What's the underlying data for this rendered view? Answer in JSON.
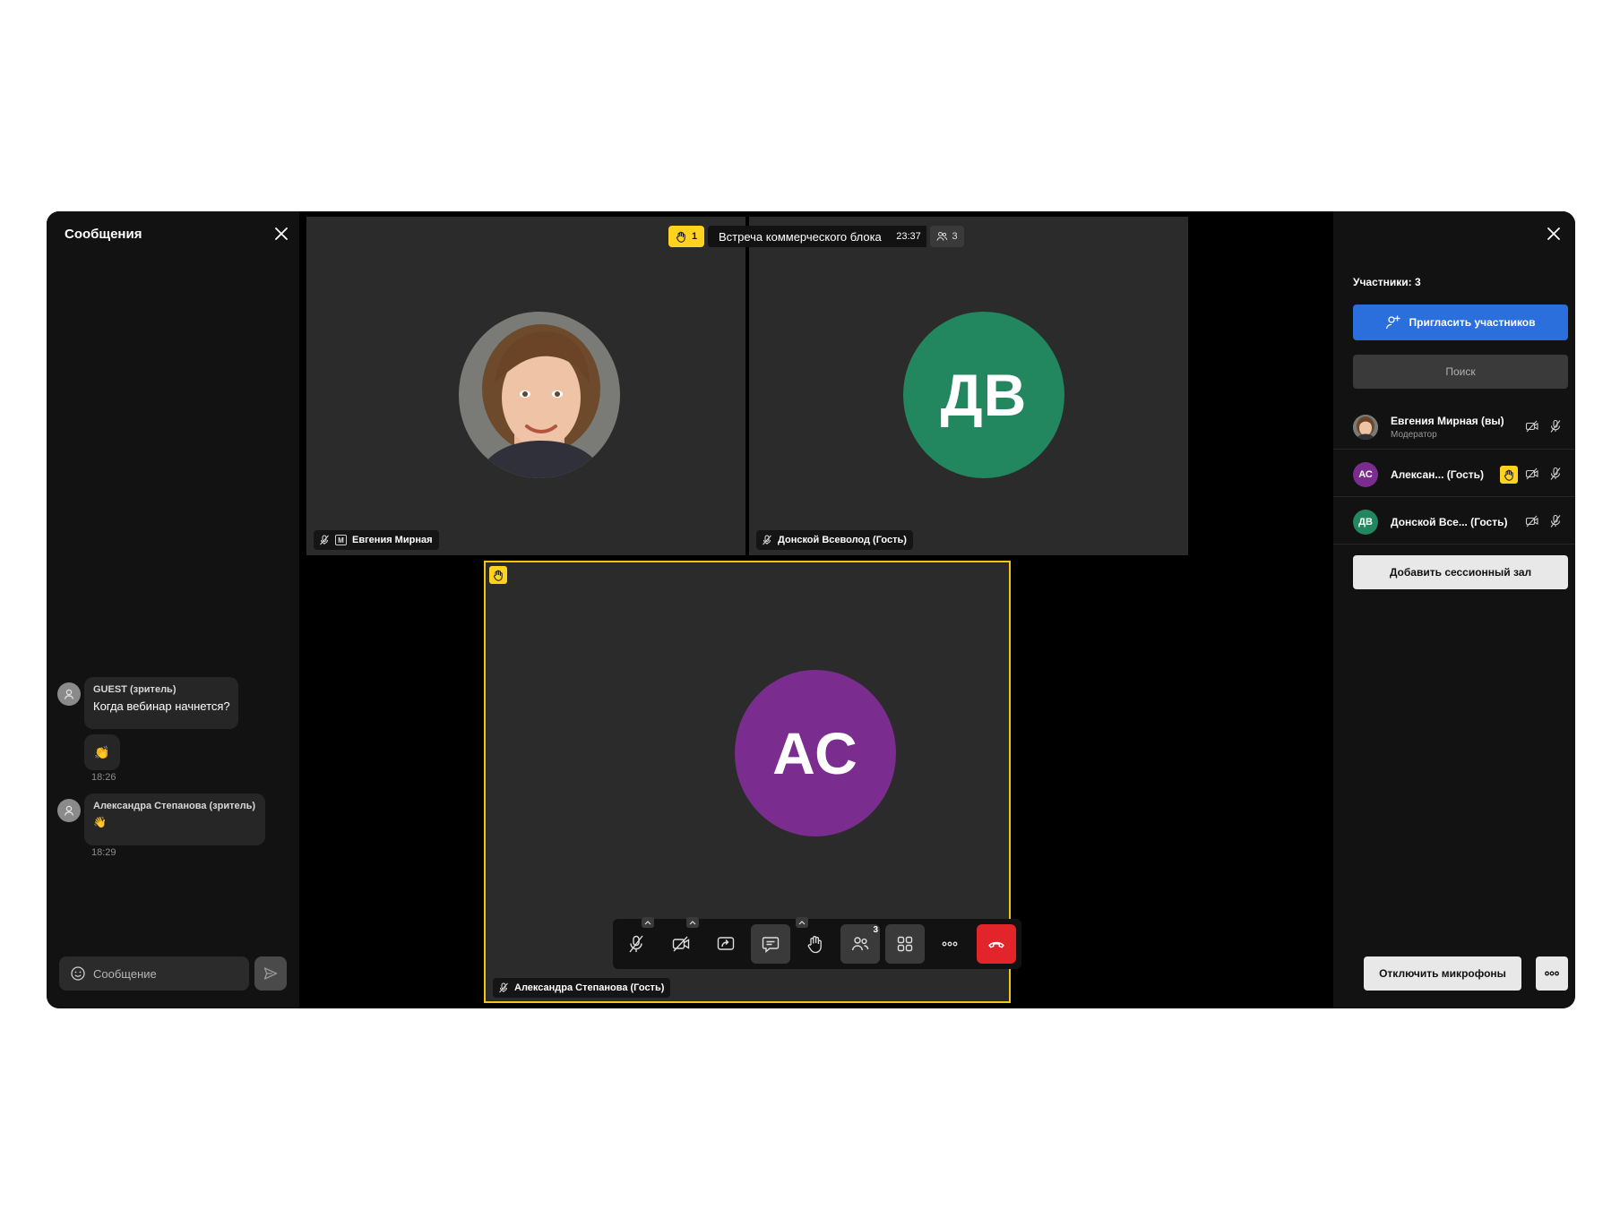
{
  "chat": {
    "title": "Сообщения",
    "messages": [
      {
        "author": "GUEST (зритель)",
        "text": "Когда вебинар начнется?",
        "reaction": "👏",
        "time": "18:26"
      },
      {
        "author": "Александра Степанова (зритель)",
        "text": "👋",
        "time": "18:29"
      }
    ],
    "input_placeholder": "Сообщение"
  },
  "meeting": {
    "raised_hands": "1",
    "title": "Встреча коммерческого блока",
    "timer": "23:37",
    "participants_count": "3"
  },
  "tiles": [
    {
      "name": "Евгения Мирная",
      "moderator_badge": "M"
    },
    {
      "name": "Донской Всеволод (Гость)",
      "initials": "ДВ",
      "color": "#22875f"
    },
    {
      "name": "Александра Степанова (Гость)",
      "initials": "АС",
      "color": "#7b2d8f",
      "active_border": "#f2c414"
    }
  ],
  "toolbar": {
    "participants_badge": "3",
    "items": [
      "mic-off-icon",
      "camera-off-icon",
      "share-screen-icon",
      "chat-icon",
      "raise-hand-icon",
      "participants-icon",
      "layout-grid-icon",
      "more-icon",
      "end-call-icon"
    ],
    "end_call_color": "#e3242b"
  },
  "participants": {
    "count_label": "Участники: 3",
    "invite_label": "Пригласить участников",
    "search_placeholder": "Поиск",
    "list": [
      {
        "name": "Евгения Мирная (вы)",
        "role": "Модератор"
      },
      {
        "initials": "АС",
        "name": "Алексан...  (Гость)",
        "color": "#7b2d8f",
        "hand_raised": true
      },
      {
        "initials": "ДВ",
        "name": "Донской Все...  (Гость)",
        "color": "#22875f"
      }
    ],
    "session_room_label": "Добавить сессионный зал",
    "mute_all_label": "Отключить микрофоны"
  },
  "colors": {
    "accent": "#2a6fdb",
    "hand": "#ffd21f"
  }
}
